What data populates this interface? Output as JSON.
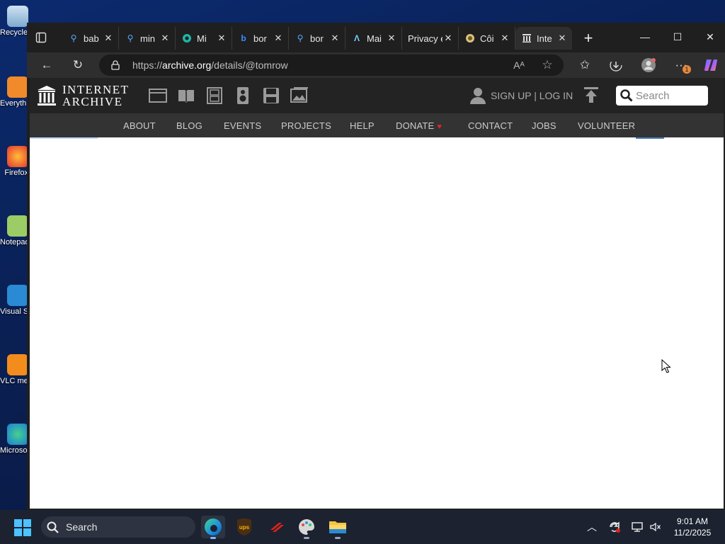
{
  "desktop": {
    "icons": [
      {
        "label": "Recycle Bin"
      },
      {
        "label": "Everything"
      },
      {
        "label": "Firefox"
      },
      {
        "label": "Notepad++"
      },
      {
        "label": "Visual Studio Code"
      },
      {
        "label": "VLC media player"
      },
      {
        "label": "Microsoft Edge"
      }
    ]
  },
  "browser": {
    "tabs": [
      {
        "title": "bab",
        "icon": "search-icon"
      },
      {
        "title": "min",
        "icon": "search-icon"
      },
      {
        "title": "Mi",
        "icon": "site-icon"
      },
      {
        "title": "bor",
        "icon": "bing-icon"
      },
      {
        "title": "bor",
        "icon": "search-icon"
      },
      {
        "title": "Mai",
        "icon": "site-icon"
      },
      {
        "title": "Privacy e",
        "icon": "none"
      },
      {
        "title": "Côi",
        "icon": "site-icon"
      },
      {
        "title": "Inte",
        "icon": "internet-archive-icon",
        "active": true
      }
    ],
    "url_prefix": "https://",
    "url_domain": "archive.org",
    "url_path": "/details/@tomrow",
    "notification_badge": "1"
  },
  "archive": {
    "logo_line1": "INTERNET",
    "logo_line2": "ARCHIVE",
    "signup_login": "SIGN UP | LOG IN",
    "search_placeholder": "Search",
    "nav": [
      "ABOUT",
      "BLOG",
      "EVENTS",
      "PROJECTS",
      "HELP",
      "DONATE",
      "CONTACT",
      "JOBS",
      "VOLUNTEER"
    ]
  },
  "taskbar": {
    "search_placeholder": "Search",
    "time": "9:01 AM",
    "date": "11/2/2025"
  },
  "colors": {
    "accent": "#4cc2ff",
    "ia_header": "#232323",
    "ia_nav": "#333333",
    "donate_heart": "#e0232b"
  }
}
